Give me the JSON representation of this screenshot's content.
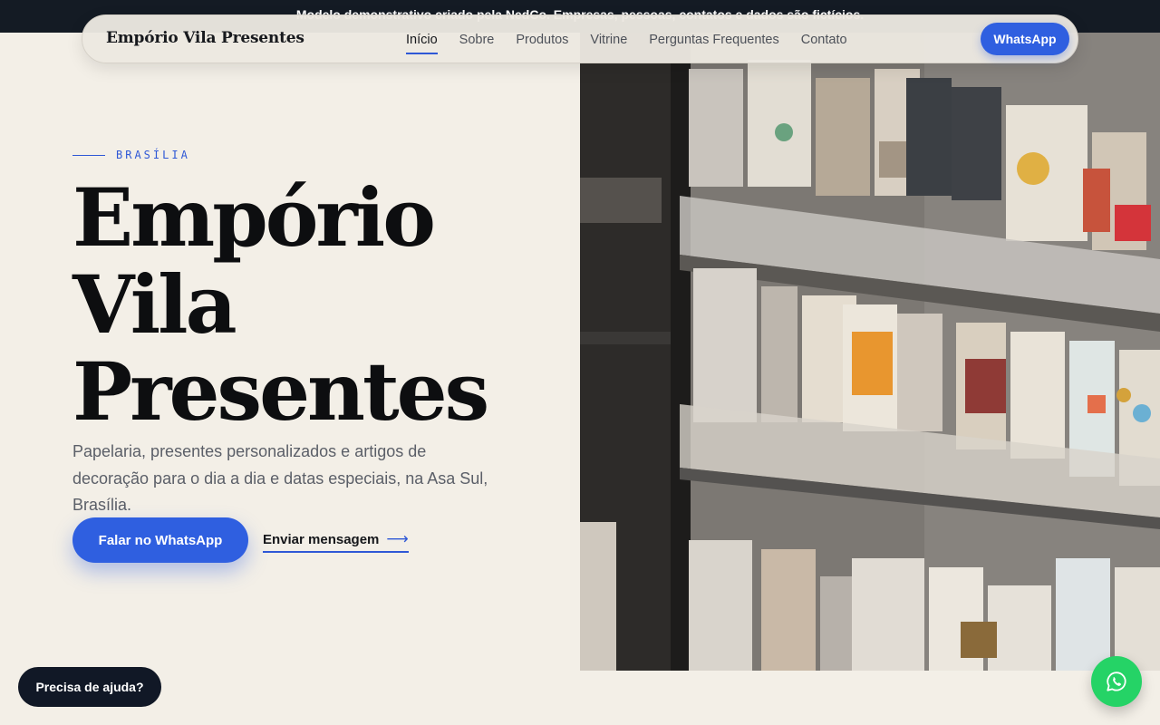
{
  "banner": {
    "text": "Modelo demonstrativo criado pela NedCo. Empresas, pessoas, contatos e dados são fictícios."
  },
  "header": {
    "brand": "Empório Vila Presentes",
    "nav": [
      {
        "label": "Início",
        "active": true
      },
      {
        "label": "Sobre",
        "active": false
      },
      {
        "label": "Produtos",
        "active": false
      },
      {
        "label": "Vitrine",
        "active": false
      },
      {
        "label": "Perguntas Frequentes",
        "active": false
      },
      {
        "label": "Contato",
        "active": false
      }
    ],
    "cta_label": "WhatsApp"
  },
  "hero": {
    "eyebrow": "BRASÍLIA",
    "title_lines": [
      "Empório",
      "Vila",
      "Presentes"
    ],
    "description": "Papelaria, presentes personalizados e artigos de decoração para o dia a dia e datas especiais, na Asa Sul, Brasília.",
    "primary_button": "Falar no WhatsApp",
    "secondary_link": "Enviar mensagem",
    "secondary_arrow": "⟶",
    "image_icon": "stationery-shelf-photo"
  },
  "floating": {
    "help_label": "Precisa de ajuda?",
    "whatsapp_icon": "whatsapp-icon"
  },
  "colors": {
    "accent": "#2f5fe0",
    "background": "#f3efe7",
    "dark": "#111826",
    "whatsapp": "#25d366"
  }
}
